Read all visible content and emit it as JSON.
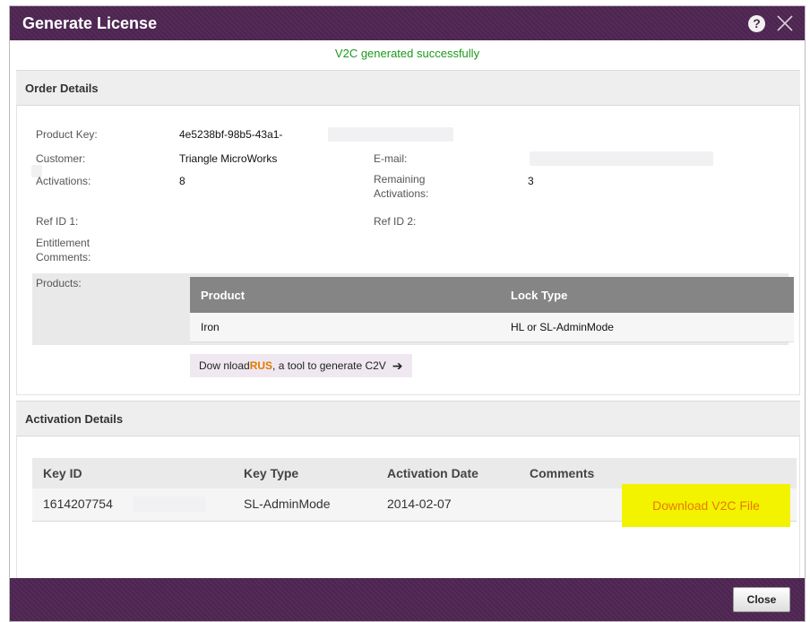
{
  "dialog": {
    "title": "Generate License",
    "help_glyph": "?",
    "status_message": "V2C generated successfully"
  },
  "order_details": {
    "heading": "Order Details",
    "product_key_label": "Product Key:",
    "product_key_value": "4e5238bf-98b5-43a1-",
    "customer_label": "Customer:",
    "customer_value": "Triangle MicroWorks",
    "email_label": "E-mail:",
    "activations_label": "Activations:",
    "activations_value": "8",
    "remaining_label_line1": "Remaining",
    "remaining_label_line2": "Activations:",
    "remaining_value": "3",
    "ref_id1_label": "Ref ID 1:",
    "ref_id2_label": "Ref ID 2:",
    "entitlement_label_line1": "Entitlement",
    "entitlement_label_line2": "Comments:",
    "products_label": "Products:",
    "products_table": {
      "headers": [
        "Product",
        "Lock Type"
      ],
      "rows": [
        [
          "Iron",
          "HL or SL-AdminMode"
        ]
      ]
    },
    "rus_prefix": "Dow nload ",
    "rus_link": "RUS",
    "rus_suffix": ", a tool to generate C2V"
  },
  "activation_details": {
    "heading": "Activation Details",
    "headers": [
      "Key ID",
      "Key Type",
      "Activation Date",
      "Comments"
    ],
    "rows": [
      {
        "key_id": "1614207754",
        "key_type": "SL-AdminMode",
        "activation_date": "2014-02-07",
        "comments": "",
        "action": "Download V2C File"
      }
    ]
  },
  "footer": {
    "close_label": "Close"
  },
  "colors": {
    "brand_purple": "#4f2553",
    "success_green": "#1a9a1a",
    "link_orange": "#e07b00",
    "highlight_yellow": "#f3f300"
  }
}
